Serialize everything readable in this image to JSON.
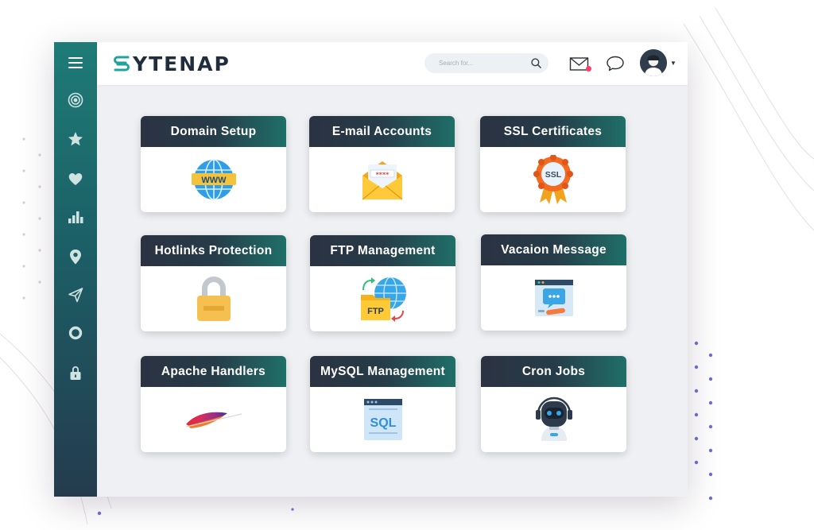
{
  "app": {
    "logo_text": "YTENAP",
    "logo_icon": "stacked-s-icon"
  },
  "topbar": {
    "search_placeholder": "Search for...",
    "icons": [
      "search-icon",
      "mail-icon",
      "chat-icon",
      "user-avatar"
    ],
    "mail_has_notification": true
  },
  "sidebar": {
    "items": [
      {
        "icon": "menu-icon"
      },
      {
        "icon": "target-icon"
      },
      {
        "icon": "star-icon"
      },
      {
        "icon": "heart-icon"
      },
      {
        "icon": "bar-chart-icon"
      },
      {
        "icon": "map-pin-icon"
      },
      {
        "icon": "send-icon"
      },
      {
        "icon": "ring-icon"
      },
      {
        "icon": "lock-icon"
      }
    ]
  },
  "cards": [
    {
      "title": "Domain Setup",
      "icon": "www-globe-icon"
    },
    {
      "title": "E-mail Accounts",
      "icon": "envelope-password-icon"
    },
    {
      "title": "SSL Certificates",
      "icon": "ssl-badge-icon"
    },
    {
      "title": "Hotlinks Protection",
      "icon": "padlock-icon"
    },
    {
      "title": "FTP Management",
      "icon": "ftp-folder-globe-icon"
    },
    {
      "title": "Vacaion Message",
      "icon": "message-window-icon"
    },
    {
      "title": "Apache Handlers",
      "icon": "apache-feather-icon"
    },
    {
      "title": "MySQL Management",
      "icon": "sql-database-icon"
    },
    {
      "title": "Cron Jobs",
      "icon": "robot-icon"
    }
  ],
  "colors": {
    "sidebar_top": "#1e7b77",
    "sidebar_bottom": "#243b4e",
    "card_header_dark": "#2b3242",
    "card_header_teal": "#1f6f69",
    "notification_dot": "#ff3d6b",
    "logo_accent": "#1fa39b"
  }
}
